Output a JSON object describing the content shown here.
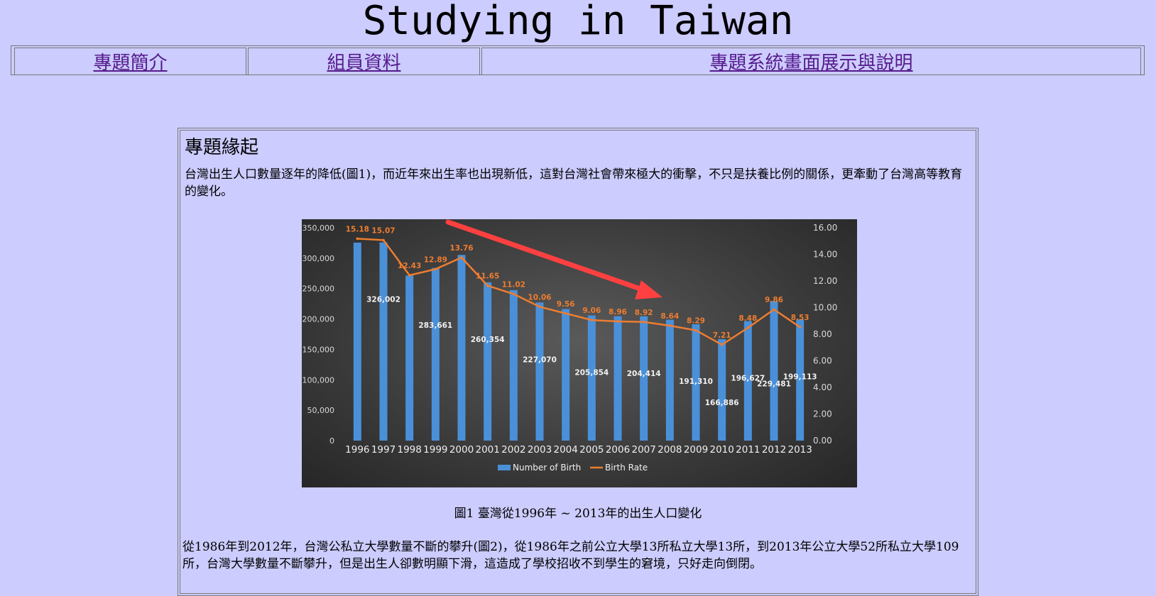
{
  "site": {
    "title": "Studying in Taiwan"
  },
  "nav": {
    "items": [
      "專題簡介",
      "組員資料",
      "專題系統畫面展示與說明"
    ]
  },
  "section": {
    "heading": "專題緣起",
    "para1": "台灣出生人口數量逐年的降低(圖1)，而近年來出生率也出現新低，這對台灣社會帶來極大的衝擊，不只是扶養比例的關係，更牽動了台灣高等教育的變化。",
    "caption": "圖1 臺灣從1996年 ~ 2013年的出生人口變化",
    "para2": "從1986年到2012年，台灣公私立大學數量不斷的攀升(圖2)，從1986年之前公立大學13所私立大學13所，到2013年公立大學52所私立大學109所，台灣大學數量不斷攀升，但是出生人卻數明顯下滑，這造成了學校招收不到學生的窘境，只好走向倒閉。"
  },
  "chart_data": {
    "type": "bar",
    "categories": [
      "1996",
      "1997",
      "1998",
      "1999",
      "2000",
      "2001",
      "2002",
      "2003",
      "2004",
      "2005",
      "2006",
      "2007",
      "2008",
      "2009",
      "2010",
      "2011",
      "2012",
      "2013"
    ],
    "series": [
      {
        "name": "Number of Birth",
        "type": "bar",
        "axis": "left",
        "values": [
          325545,
          326002,
          271450,
          283661,
          305312,
          260354,
          247530,
          227070,
          216419,
          205854,
          204459,
          204414,
          198733,
          191310,
          166886,
          196627,
          229481,
          199113
        ],
        "labels": [
          "",
          "326,002",
          "",
          "283,661",
          "",
          "260,354",
          "",
          "227,070",
          "",
          "205,854",
          "",
          "204,414",
          "",
          "191,310",
          "166,886",
          "196,627",
          "229,481",
          "199,113"
        ],
        "color": "#4a90d9"
      },
      {
        "name": "Birth Rate",
        "type": "line",
        "axis": "right",
        "values": [
          15.18,
          15.07,
          12.43,
          12.89,
          13.76,
          11.65,
          11.02,
          10.06,
          9.56,
          9.06,
          8.96,
          8.92,
          8.64,
          8.29,
          7.21,
          8.48,
          9.86,
          8.53
        ],
        "labels": [
          "15.18",
          "15.07",
          "12.43",
          "12.89",
          "13.76",
          "11.65",
          "11.02",
          "10.06",
          "9.56",
          "9.06",
          "8.96",
          "8.92",
          "8.64",
          "8.29",
          "7.21",
          "8.48",
          "9.86",
          "8.53"
        ],
        "color": "#ed7d31"
      }
    ],
    "y_left": {
      "min": 0,
      "max": 350000,
      "ticks": [
        "0",
        "50,000",
        "100,000",
        "150,000",
        "200,000",
        "250,000",
        "300,000",
        "350,000"
      ]
    },
    "y_right": {
      "min": 0,
      "max": 16,
      "ticks": [
        "0.00",
        "2.00",
        "4.00",
        "6.00",
        "8.00",
        "10.00",
        "12.00",
        "14.00",
        "16.00"
      ]
    },
    "legend": "bottom",
    "grid": false,
    "annotation": {
      "type": "arrow",
      "color": "#ff4040"
    }
  }
}
